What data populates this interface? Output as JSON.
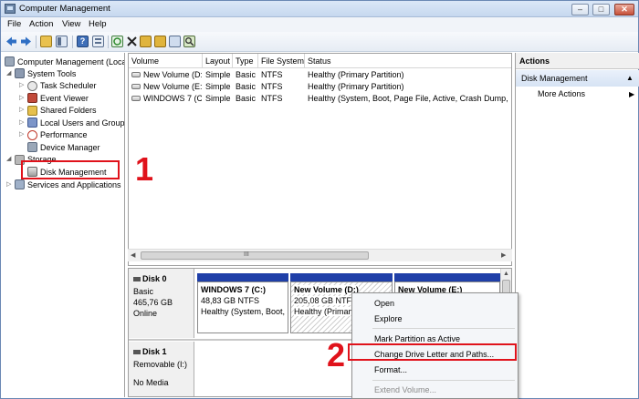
{
  "window": {
    "title": "Computer Management"
  },
  "menu": {
    "file": "File",
    "action": "Action",
    "view": "View",
    "help": "Help"
  },
  "tree": {
    "root": "Computer Management (Local",
    "system_tools": "System Tools",
    "task_scheduler": "Task Scheduler",
    "event_viewer": "Event Viewer",
    "shared_folders": "Shared Folders",
    "local_users": "Local Users and Groups",
    "performance": "Performance",
    "device_manager": "Device Manager",
    "storage": "Storage",
    "disk_management": "Disk Management",
    "services": "Services and Applications"
  },
  "list": {
    "columns": {
      "volume": "Volume",
      "layout": "Layout",
      "type": "Type",
      "fs": "File System",
      "status": "Status"
    },
    "rows": [
      {
        "volume": "New Volume (D:)",
        "layout": "Simple",
        "type": "Basic",
        "fs": "NTFS",
        "status": "Healthy (Primary Partition)"
      },
      {
        "volume": "New Volume (E:)",
        "layout": "Simple",
        "type": "Basic",
        "fs": "NTFS",
        "status": "Healthy (Primary Partition)"
      },
      {
        "volume": "WINDOWS 7 (C:)",
        "layout": "Simple",
        "type": "Basic",
        "fs": "NTFS",
        "status": "Healthy (System, Boot, Page File, Active, Crash Dump, Prima"
      }
    ],
    "scroll_grip": "III"
  },
  "disks": [
    {
      "name": "Disk 0",
      "kind": "Basic",
      "size": "465,76 GB",
      "state": "Online"
    },
    {
      "name": "Disk 1",
      "kind": "Removable (I:)",
      "state": "No Media"
    }
  ],
  "partitions": [
    {
      "name": "WINDOWS 7  (C:)",
      "size": "48,83 GB NTFS",
      "status": "Healthy (System, Boot, F"
    },
    {
      "name": "New Volume  (D:)",
      "size": "205,08 GB NTFS",
      "status": "Healthy (Primary"
    },
    {
      "name": "New Volume  (E:)"
    }
  ],
  "actions": {
    "header": "Actions",
    "section": "Disk Management",
    "more": "More Actions"
  },
  "context_menu": {
    "open": "Open",
    "explore": "Explore",
    "mark_active": "Mark Partition as Active",
    "change_letter": "Change Drive Letter and Paths...",
    "format": "Format...",
    "extend": "Extend Volume..."
  },
  "annotations": {
    "step1": "1",
    "step2": "2"
  },
  "colors": {
    "accent_red": "#e0121b",
    "partition_blue": "#1f3fa8"
  }
}
